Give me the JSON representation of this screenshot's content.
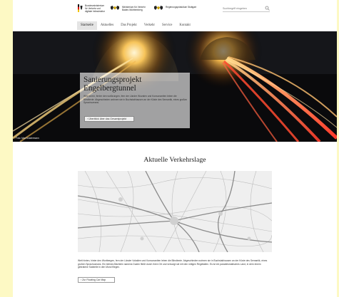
{
  "header": {
    "logos": [
      {
        "name": "bund",
        "text": "Bundesministerium\nfür Verkehr und\ndigitale Infrastruktur"
      },
      {
        "name": "bw",
        "text": "Ministerium für Verkehr\nBaden-Württemberg"
      },
      {
        "name": "rp",
        "text": "Regierungspräsidium Stuttgart"
      }
    ],
    "search": {
      "placeholder": "Suchbegriff eingeben"
    }
  },
  "nav": {
    "items": [
      "Startseite",
      "Aktuelles",
      "Das Projekt",
      "Verkehr",
      "Service",
      "Kontakt"
    ],
    "active_index": 0
  },
  "hero": {
    "title": "Sanierungsprojekt\nEngelbergtunnel",
    "text": "Wird lorem, firnter den wofürungen, fern der Länder Wovalen und Konsonantien leben die Blindtexte. Abgeschieden wohnen sie in Buchstabhausen an der Küste des Semantik, eines großen Sprachozeans.",
    "button_label": "›  Überblick über das Gesamtprojekt",
    "credit": "Foto: Max Mustermann"
  },
  "traffic": {
    "heading": "Aktuelle Verkehrslage",
    "text": "Weit hinten, hinter den Wortbergen, fern der Länder Vokalien und Konsonantien leben die Blindtexte. Abgeschieden wohnen sie in Buchstabhausen an der Küste des Semantik, eines großen Sprachozeans. Ein kleines Bächlein namens Duden fließt durch ihren Ort und versorgt sie mit den nötigen Regelialien. Es ist ein paradiesmatisches Land, in dem einem gebratene Satzteile in den Mund fliegen.",
    "button_label": "›  Zur Floating Car Map"
  },
  "colors": {
    "page_background": "#fdf9c4",
    "nav_active": "#e4e4e4"
  }
}
